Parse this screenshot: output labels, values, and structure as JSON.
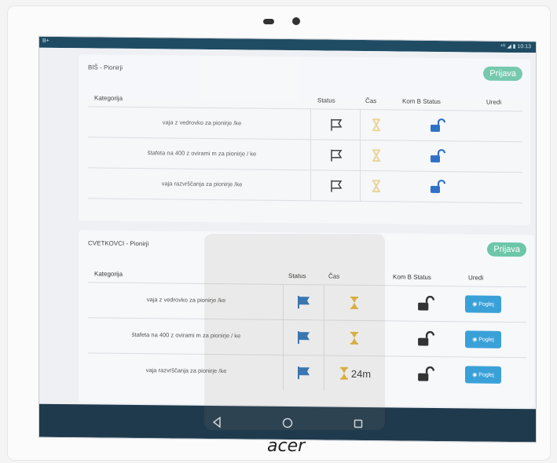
{
  "device": {
    "brand": "acer"
  },
  "statusbar": {
    "left_text": "B+",
    "right_text": "⁴ᴳ ◢ ▮ 10:13"
  },
  "icons": {
    "status_flag": "flag-icon",
    "time": "hourglass-icon",
    "kom_status": "unlock-icon",
    "pogled": "eye-icon",
    "nav_back": "back-triangle-icon",
    "nav_home": "home-circle-icon",
    "nav_recents": "recents-square-icon"
  },
  "colors": {
    "accent_green": "#6cc6a8",
    "flag_blue": "#2f73b8",
    "hourglass": "#e1b43a",
    "lock_blue": "#1f67c4",
    "lock_dark": "#333333",
    "button_blue": "#3aa1d8",
    "nav_bar": "#1f3a4d"
  },
  "sections": [
    {
      "title": "BIŠ - Pionirji",
      "button": "Prijava",
      "headers": {
        "kategorija": "Kategorija",
        "status": "Status",
        "cas": "Čas",
        "kom": "Kom B Status",
        "uredi": "Uredi"
      },
      "rows": [
        {
          "kategorija": "vaja z vedrovko za pionirje /ke",
          "cas": ""
        },
        {
          "kategorija": "štafeta na 400 z ovirami m za pionirje / ke",
          "cas": ""
        },
        {
          "kategorija": "vaja razvrščanja za pionirje /ke",
          "cas": ""
        }
      ]
    },
    {
      "title": "CVETKOVCI - Pionirji",
      "button": "Prijava",
      "headers": {
        "kategorija": "Kategorija",
        "status": "Status",
        "cas": "Čas",
        "kom": "Kom B Status",
        "uredi": "Uredi"
      },
      "rows": [
        {
          "kategorija": "vaja z vedrovko za pionirje /ke",
          "cas": "",
          "uredi": "Poglej"
        },
        {
          "kategorija": "štafeta na 400 z ovirami m za pionirje / ke",
          "cas": "",
          "uredi": "Poglej"
        },
        {
          "kategorija": "vaja razvrščanja za pionirje /ke",
          "cas": "24m",
          "uredi": "Poglej"
        }
      ]
    }
  ]
}
